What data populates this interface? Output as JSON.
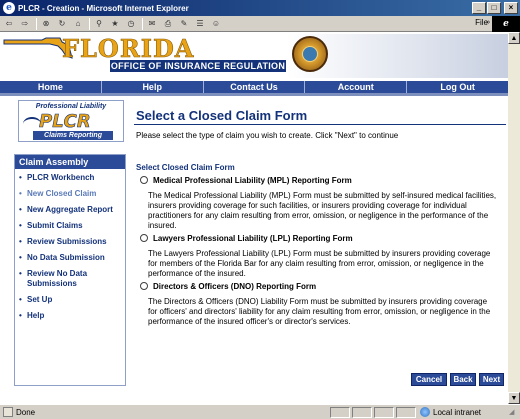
{
  "window": {
    "title": "PLCR - Creation - Microsoft Internet Explorer",
    "file_menu": "File"
  },
  "banner": {
    "state_name": "FLORIDA",
    "office": "OFFICE OF INSURANCE REGULATION"
  },
  "nav": {
    "items": [
      "Home",
      "Help",
      "Contact Us",
      "Account",
      "Log Out"
    ]
  },
  "logo": {
    "top": "Professional Liability",
    "main": "PLCR",
    "bottom": "Claims Reporting"
  },
  "sidebar": {
    "heading": "Claim Assembly",
    "items": [
      {
        "label": "PLCR Workbench"
      },
      {
        "label": "New Closed Claim"
      },
      {
        "label": "New Aggregate Report"
      },
      {
        "label": "Submit Claims"
      },
      {
        "label": "Review Submissions"
      },
      {
        "label": "No Data Submission"
      },
      {
        "label": "Review No Data Submissions"
      },
      {
        "label": "Set Up"
      },
      {
        "label": "Help"
      }
    ]
  },
  "main": {
    "title": "Select a Closed Claim Form",
    "subtitle": "Please select the type of claim you wish to create. Click \"Next\" to continue",
    "section_title": "Select Closed Claim Form",
    "options": [
      {
        "label": "Medical Professional Liability (MPL) Reporting Form",
        "description": "The Medical Professional Liability (MPL) Form must be submitted by self-insured medical facilities, insurers providing coverage for such facilities, or insurers providing coverage for individual practitioners for any claim resulting from error, omission, or negligence in the performance of the insured."
      },
      {
        "label": "Lawyers Professional Liability (LPL) Reporting Form",
        "description": "The Lawyers Professional Liability (LPL) Form must be submitted by insurers providing coverage for members of the Florida Bar for any claim resulting from error, omission, or negligence in the performance of the insured."
      },
      {
        "label": "Directors & Officers (DNO) Reporting Form",
        "description": "The Directors & Officers (DNO) Liability Form must be submitted by insurers providing coverage for officers' and directors' liability for any claim resulting from error, omission, or negligence in the performance of the insured officer's or director's services."
      }
    ]
  },
  "buttons": {
    "cancel": "Cancel",
    "back": "Back",
    "next": "Next"
  },
  "status": {
    "text": "Done",
    "zone": "Local intranet"
  }
}
